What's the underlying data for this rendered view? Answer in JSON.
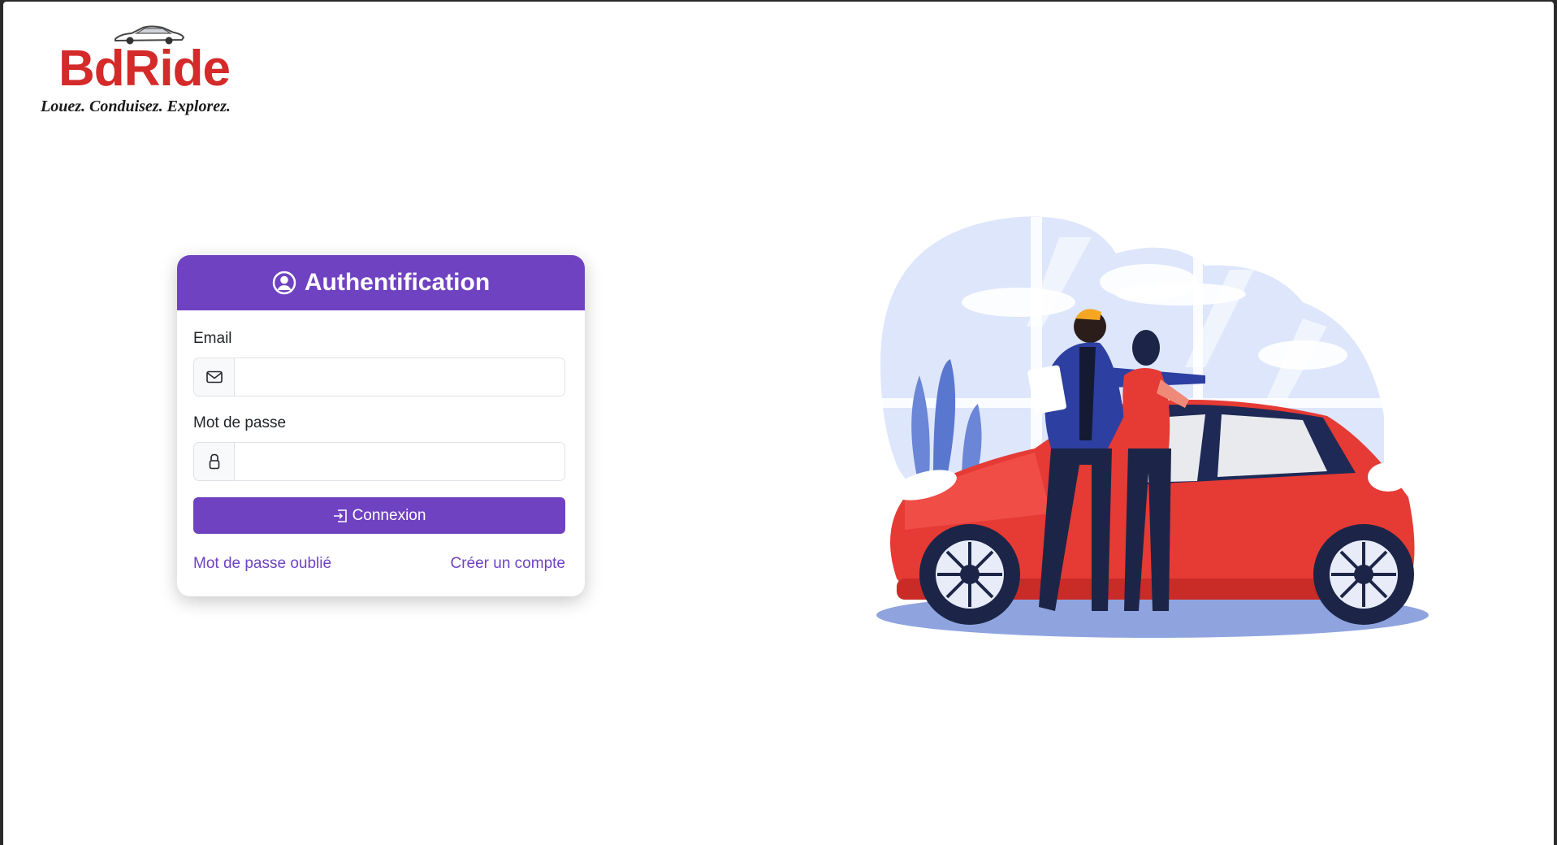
{
  "brand": {
    "name": "BdRide",
    "tagline": "Louez. Conduisez. Explorez.",
    "color": "#d42a2a"
  },
  "login_card": {
    "title": "Authentification",
    "title_icon": "user-circle-icon",
    "accent_color": "#6f42c1",
    "email": {
      "label": "Email",
      "icon": "envelope-icon",
      "value": "",
      "placeholder": ""
    },
    "password": {
      "label": "Mot de passe",
      "icon": "lock-icon",
      "value": "",
      "placeholder": ""
    },
    "submit": {
      "label": "Connexion",
      "icon": "box-arrow-in-right-icon"
    },
    "forgot_password_link": "Mot de passe oublié",
    "create_account_link": "Créer un compte"
  },
  "illustration": {
    "subject": "car-showroom-illustration",
    "car_color": "#e63a35"
  }
}
